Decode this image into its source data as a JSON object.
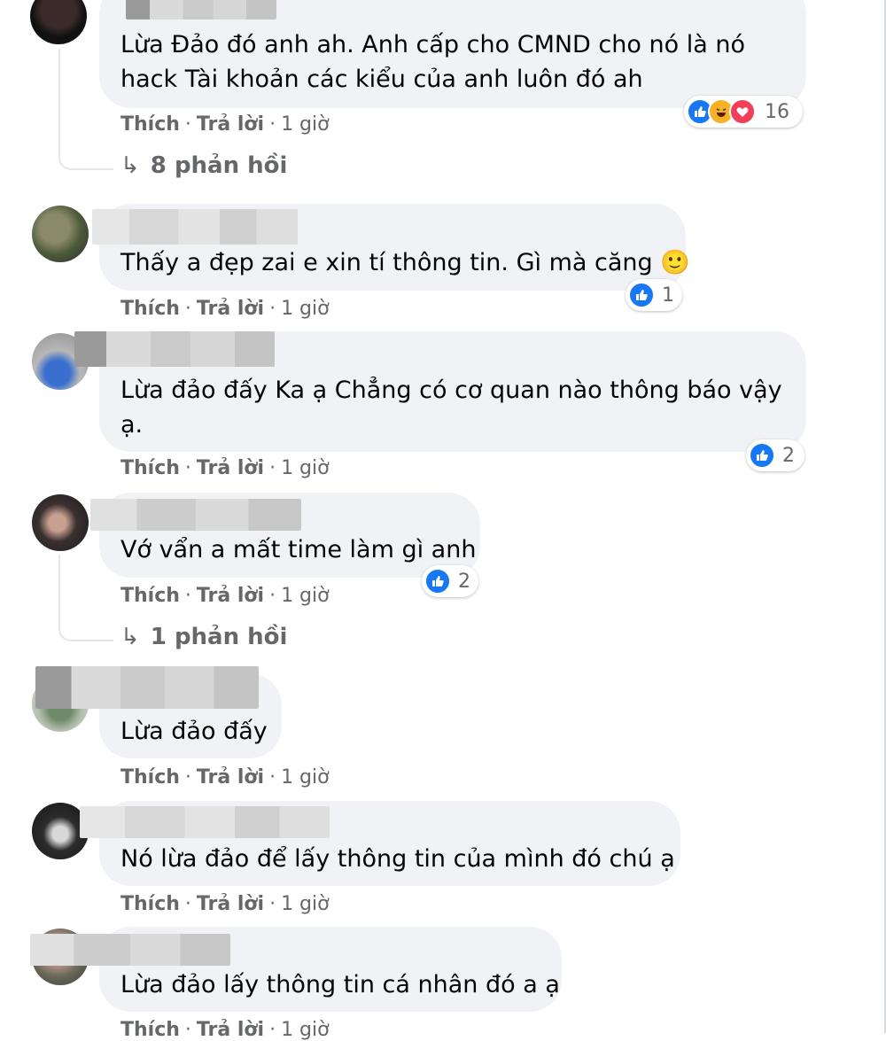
{
  "actions": {
    "like": "Thích",
    "reply": "Trả lời",
    "separator": "·"
  },
  "comments": [
    {
      "text_lines": [
        "Lừa Đảo đó anh ah. Anh cấp cho CMND cho nó là nó",
        "hack Tài khoản các kiểu của anh luôn đó ah"
      ],
      "time": "1 giờ",
      "reaction_count": "16",
      "reaction_icons": [
        "like-icon",
        "haha-icon",
        "love-icon"
      ],
      "replies": "8 phản hồi"
    },
    {
      "text_lines": [
        "Thấy a đẹp zai e xin tí thông tin. Gì mà căng 🙂"
      ],
      "time": "1 giờ",
      "reaction_count": "1",
      "reaction_icons": [
        "like-icon"
      ]
    },
    {
      "text_lines": [
        "Lừa đảo đấy Ka ạ Chẳng có cơ quan nào thông báo vậy",
        "ạ."
      ],
      "time": "1 giờ",
      "reaction_count": "2",
      "reaction_icons": [
        "like-icon"
      ]
    },
    {
      "text_lines": [
        "Vớ vẩn a mất time làm gì anh"
      ],
      "time": "1 giờ",
      "reaction_count": "2",
      "reaction_icons": [
        "like-icon"
      ],
      "replies": "1 phản hồi"
    },
    {
      "text_lines": [
        "Lừa đảo đấy"
      ],
      "time": "1 giờ"
    },
    {
      "text_lines": [
        "Nó lừa đảo để lấy thông tin của mình đó chú ạ"
      ],
      "time": "1 giờ"
    },
    {
      "text_lines": [
        "Lừa đảo lấy thông tin cá nhân đó a ạ"
      ],
      "time": "1 giờ"
    }
  ],
  "colors": {
    "bubble": "#f0f2f5",
    "like": "#1877f2",
    "meta": "#65676b"
  }
}
